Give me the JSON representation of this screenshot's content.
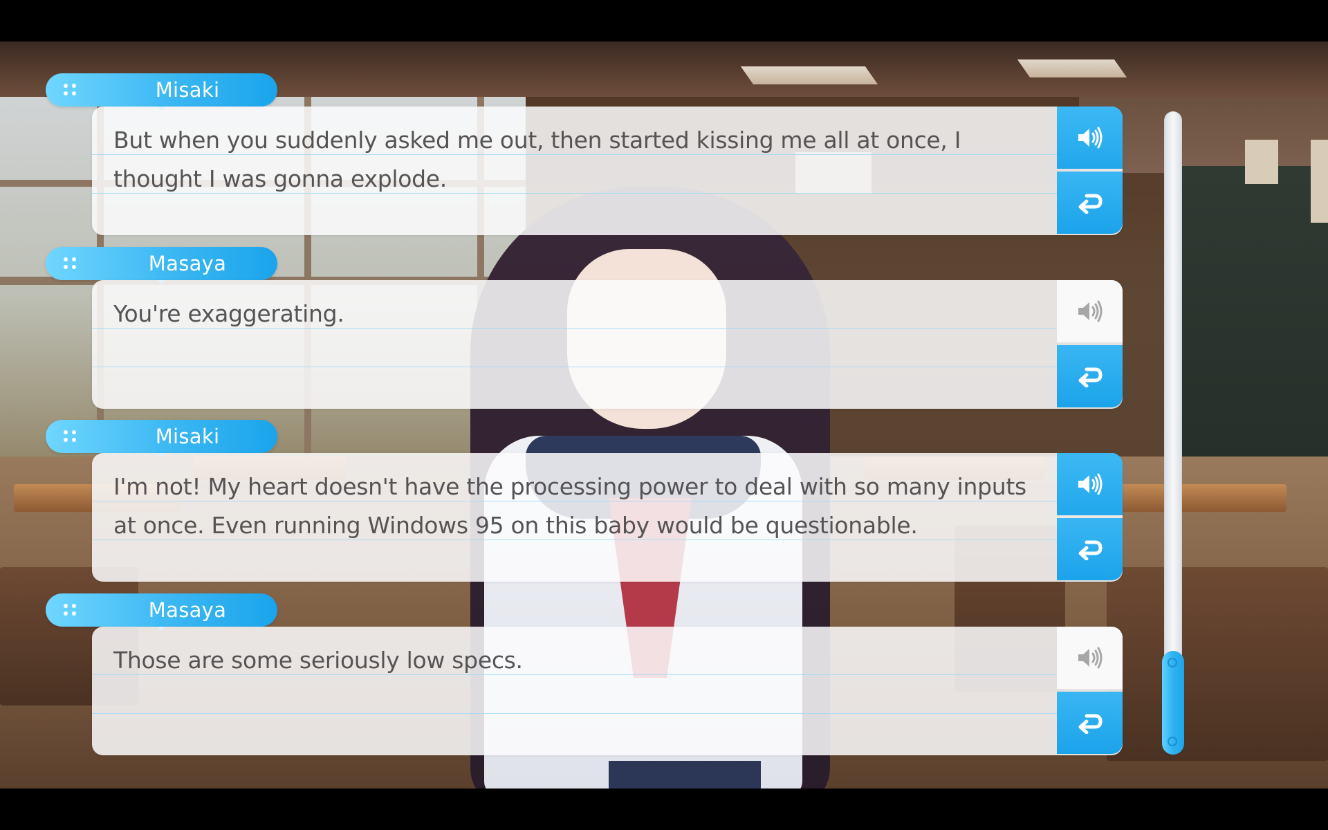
{
  "backlog": {
    "entries": [
      {
        "speaker": "Misaki",
        "text": "But when you suddenly asked me out, then started kissing me all at once, I thought I was gonna explode.",
        "has_voice": true
      },
      {
        "speaker": "Masaya",
        "text": "You're exaggerating.",
        "has_voice": false
      },
      {
        "speaker": "Misaki",
        "text": "I'm not! My heart doesn't have the processing power to deal with so many inputs at once. Even running Windows 95 on this baby would be questionable.",
        "has_voice": true
      },
      {
        "speaker": "Masaya",
        "text": "Those are some seriously low specs.",
        "has_voice": false
      }
    ],
    "icons": {
      "voice": "speaker-icon",
      "jump": "return-arrow-icon",
      "grip": "drag-grip-icon"
    },
    "scroll_position": 1.0
  },
  "colors": {
    "accent": "#2eb2f2",
    "accent_light": "#6fd6ff",
    "text": "#555354",
    "rule": "#9fd8f5",
    "voice_inactive": "#a7a7a7"
  }
}
